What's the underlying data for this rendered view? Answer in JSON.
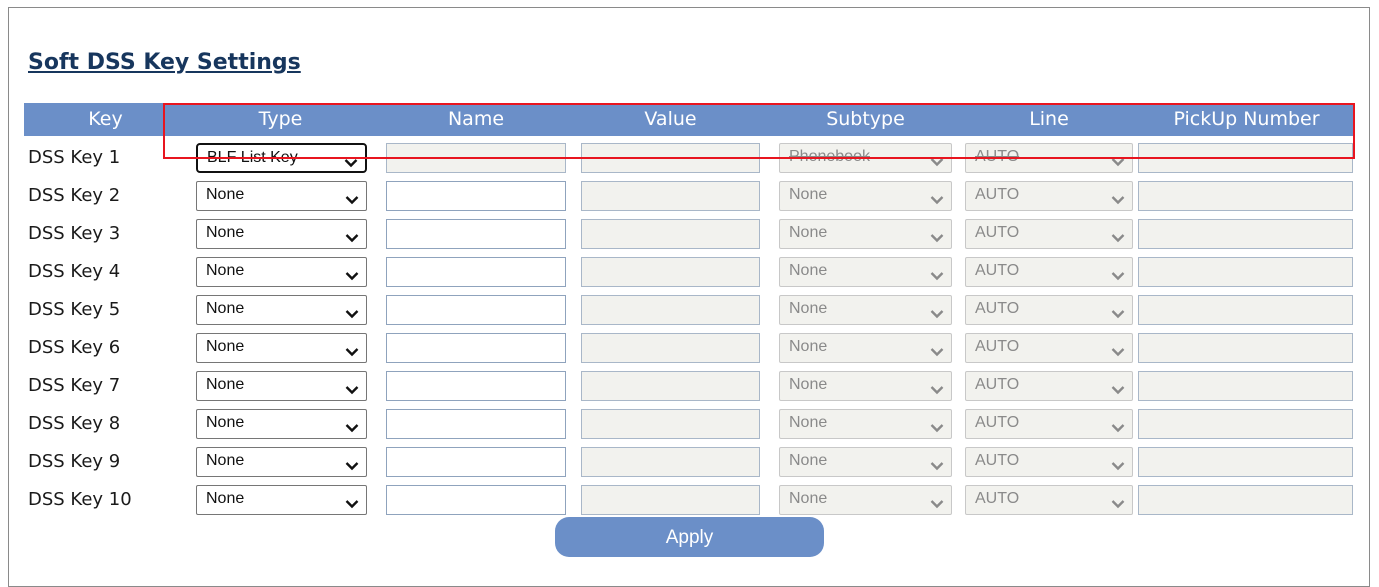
{
  "page_title": "Soft DSS Key Settings",
  "columns": [
    "Key",
    "Type",
    "Name",
    "Value",
    "Subtype",
    "Line",
    "PickUp Number"
  ],
  "rows": [
    {
      "key": "DSS Key 1",
      "type": "BLF List Key",
      "name": "",
      "value": "",
      "subtype": "Phonebook",
      "line": "AUTO",
      "pickup": ""
    },
    {
      "key": "DSS Key 2",
      "type": "None",
      "name": "",
      "value": "",
      "subtype": "None",
      "line": "AUTO",
      "pickup": ""
    },
    {
      "key": "DSS Key 3",
      "type": "None",
      "name": "",
      "value": "",
      "subtype": "None",
      "line": "AUTO",
      "pickup": ""
    },
    {
      "key": "DSS Key 4",
      "type": "None",
      "name": "",
      "value": "",
      "subtype": "None",
      "line": "AUTO",
      "pickup": ""
    },
    {
      "key": "DSS Key 5",
      "type": "None",
      "name": "",
      "value": "",
      "subtype": "None",
      "line": "AUTO",
      "pickup": ""
    },
    {
      "key": "DSS Key 6",
      "type": "None",
      "name": "",
      "value": "",
      "subtype": "None",
      "line": "AUTO",
      "pickup": ""
    },
    {
      "key": "DSS Key 7",
      "type": "None",
      "name": "",
      "value": "",
      "subtype": "None",
      "line": "AUTO",
      "pickup": ""
    },
    {
      "key": "DSS Key 8",
      "type": "None",
      "name": "",
      "value": "",
      "subtype": "None",
      "line": "AUTO",
      "pickup": ""
    },
    {
      "key": "DSS Key 9",
      "type": "None",
      "name": "",
      "value": "",
      "subtype": "None",
      "line": "AUTO",
      "pickup": ""
    },
    {
      "key": "DSS Key 10",
      "type": "None",
      "name": "",
      "value": "",
      "subtype": "None",
      "line": "AUTO",
      "pickup": ""
    }
  ],
  "apply_label": "Apply",
  "colors": {
    "header": "#6b8fc8",
    "title": "#17365d",
    "annotation": "#e8151f"
  },
  "icons": {
    "dropdown": "chevron-down-icon"
  }
}
